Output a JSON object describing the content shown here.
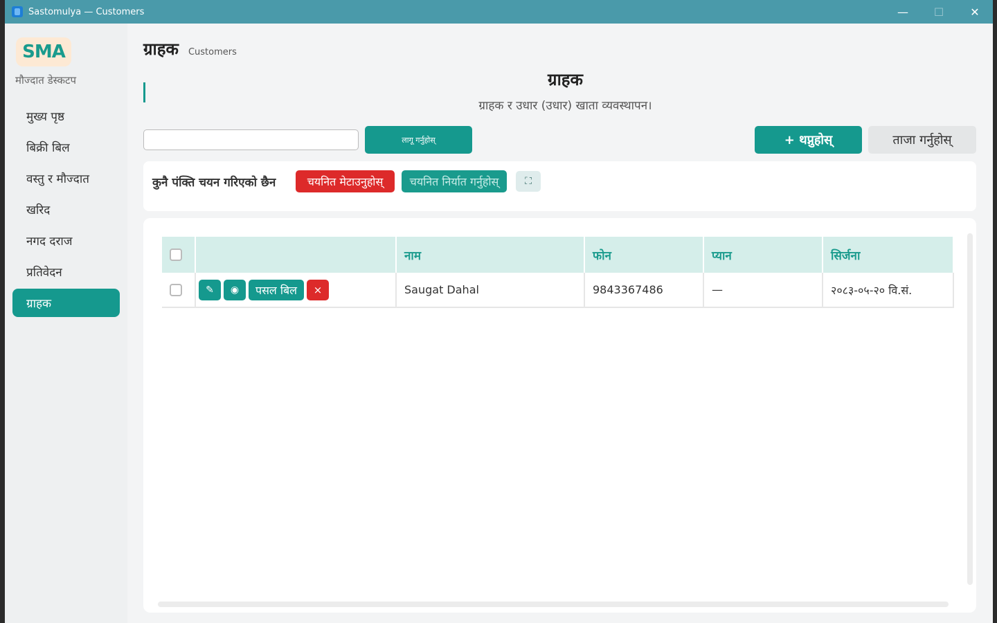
{
  "window": {
    "title": "Sastomulya — Customers"
  },
  "sidebar": {
    "logo": "SMA",
    "caption": "मौज्दात डेस्कटप",
    "items": [
      {
        "label": "मुख्य पृष्ठ"
      },
      {
        "label": "बिक्री बिल"
      },
      {
        "label": "वस्तु र मौज्दात"
      },
      {
        "label": "खरिद"
      },
      {
        "label": "नगद दराज"
      },
      {
        "label": "प्रतिवेदन"
      },
      {
        "label": "ग्राहक",
        "active": true
      }
    ]
  },
  "header": {
    "title": "ग्राहक",
    "subtitle": "Customers"
  },
  "section": {
    "title": "ग्राहक",
    "description": "ग्राहक र उधार (उधार) खाता व्यवस्थापन।"
  },
  "toolbar": {
    "search_value": "",
    "apply_label": "लागू गर्नुहोस्",
    "add_label": "+ थप्नुहोस्",
    "refresh_label": "ताजा गर्नुहोस्"
  },
  "selection": {
    "status": "कुनै पंक्ति चयन गरिएको छैन",
    "delete_label": "चयनित मेटाउनुहोस्",
    "export_label": "चयनित निर्यात गर्नुहोस्",
    "fullscreen_icon": "⛶"
  },
  "table": {
    "columns": [
      "",
      "",
      "नाम",
      "फोन",
      "प्यान",
      "सिर्जना"
    ],
    "rows": [
      {
        "name": "Saugat Dahal",
        "phone": "9843367486",
        "pan": "—",
        "created": "२०८३-०५-२० वि.सं.",
        "bill_label": "पसल बिल",
        "edit_icon": "✎",
        "view_icon": "◉",
        "delete_icon": "×"
      }
    ]
  },
  "colors": {
    "accent": "#15998e",
    "danger": "#dd2a2a",
    "titlebar": "#4a9aaa",
    "header_row": "#d5eeea"
  }
}
